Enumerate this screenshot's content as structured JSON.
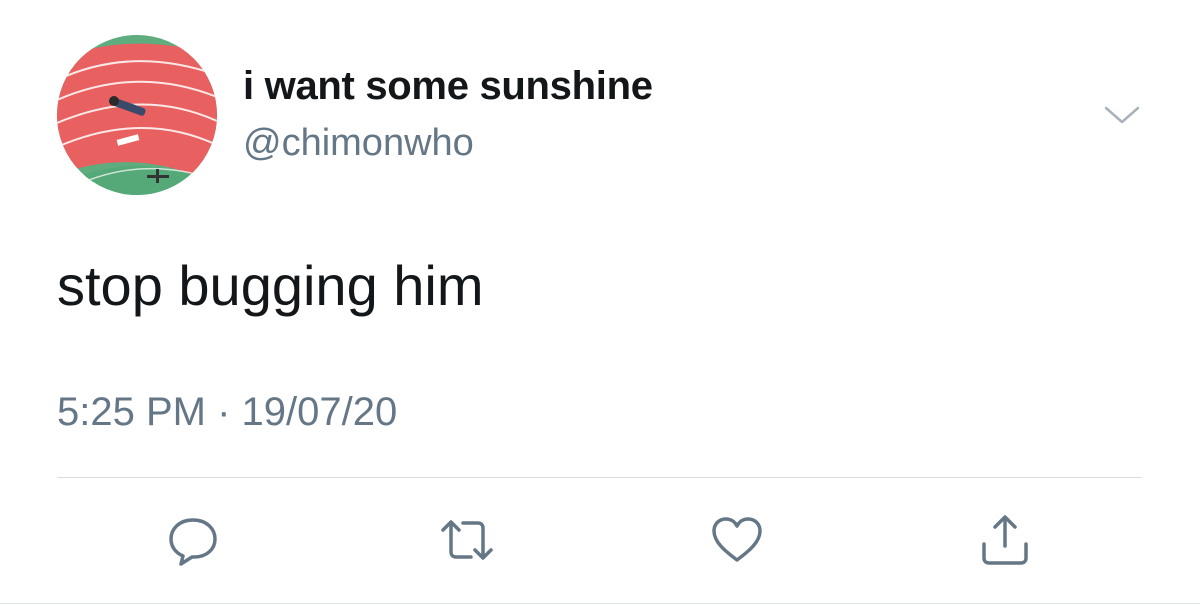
{
  "tweet": {
    "display_name": "i want some sunshine",
    "handle": "@chimonwho",
    "text": "stop bugging him",
    "timestamp": "5:25 PM · 19/07/20"
  },
  "icons": {
    "menu": "chevron-down-icon",
    "reply": "reply-icon",
    "retweet": "retweet-icon",
    "like": "heart-icon",
    "share": "share-icon"
  },
  "colors": {
    "text_primary": "#14171a",
    "text_secondary": "#657786",
    "icon": "#657786",
    "divider": "#d9dde2",
    "avatar_track": "#e8605f",
    "avatar_field": "#5fad7f"
  }
}
